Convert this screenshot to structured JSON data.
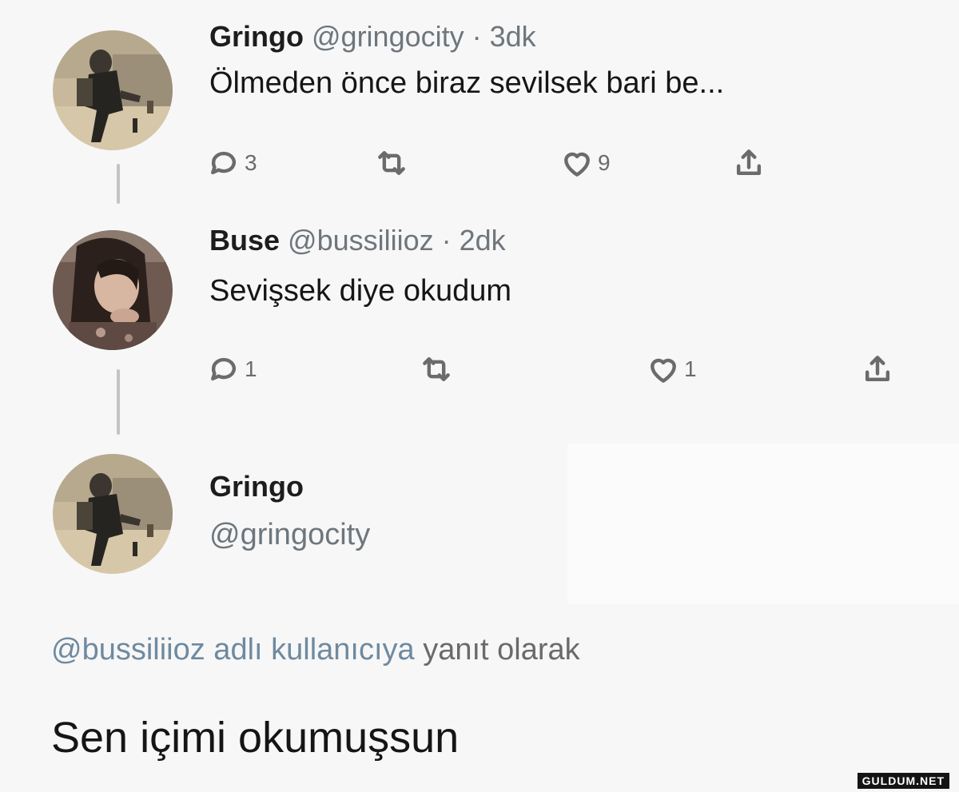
{
  "tweets": [
    {
      "name": "Gringo",
      "handle": "@gringocity · 3dk",
      "text": "Ölmeden önce biraz sevilsek bari be...",
      "replies": "3",
      "likes": "9"
    },
    {
      "name": "Buse",
      "handle": "@bussiliioz · 2dk",
      "text": "Sevişsek diye okudum",
      "replies": "1",
      "likes": "1"
    }
  ],
  "main_tweet": {
    "name": "Gringo",
    "handle": "@gringocity",
    "reply_mention": "@bussiliioz adlı kullanıcıya",
    "reply_rest": " yanıt olarak",
    "text": "Sen içimi okumuşsun"
  },
  "watermark": "GULDUM.NET",
  "icons": {
    "reply": "reply-icon",
    "retweet": "retweet-icon",
    "like": "heart-icon",
    "share": "share-icon"
  }
}
